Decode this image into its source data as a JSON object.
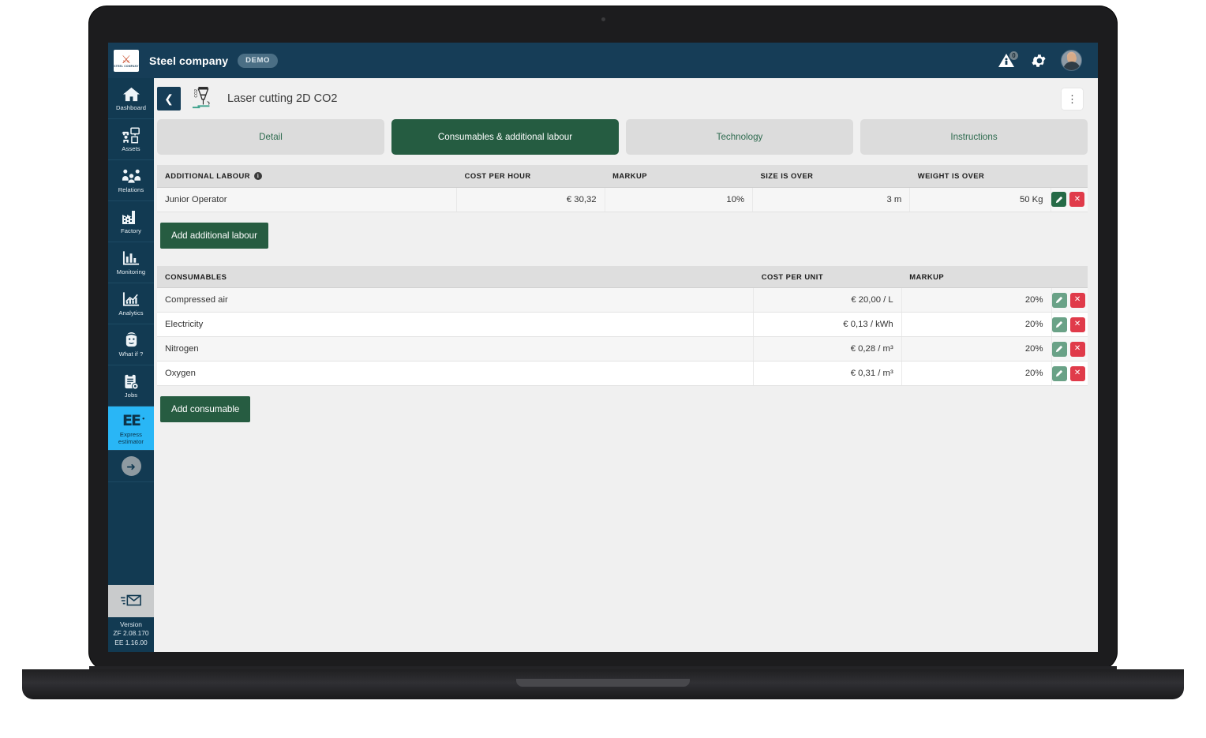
{
  "topbar": {
    "logo_mark": "steel-company-logo",
    "logo_text": "STEEL COMPANY",
    "company": "Steel company",
    "demo_badge": "DEMO",
    "alert_count": "0",
    "icons": [
      "alert-triangle-icon",
      "gear-icon",
      "avatar"
    ]
  },
  "sidebar": {
    "items": [
      {
        "label": "Dashboard",
        "icon": "home-icon",
        "active": false
      },
      {
        "label": "Assets",
        "icon": "assets-icon",
        "active": false
      },
      {
        "label": "Relations",
        "icon": "relations-icon",
        "active": false
      },
      {
        "label": "Factory",
        "icon": "factory-icon",
        "active": false
      },
      {
        "label": "Monitoring",
        "icon": "bar-chart-icon",
        "active": false
      },
      {
        "label": "Analytics",
        "icon": "analytics-icon",
        "active": false
      },
      {
        "label": "What if ?",
        "icon": "face-thinking-icon",
        "active": false
      },
      {
        "label": "Jobs",
        "icon": "clipboard-gear-icon",
        "active": false
      },
      {
        "label": "Express estimator",
        "icon": "ee-logo-icon",
        "active": true
      }
    ],
    "collapse_arrow": "arrow-right-circle-icon",
    "mail_icon": "mail-send-icon",
    "version_label": "Version",
    "version_zf": "ZF  2.08.170",
    "version_ee": "EE  1.16.00"
  },
  "page": {
    "back_icon": "chevron-left-icon",
    "title_icon": "laser-cutting-co2-icon",
    "title": "Laser cutting 2D CO2",
    "kebab_icon": "more-vertical-icon"
  },
  "tabs": [
    {
      "label": "Detail",
      "active": false
    },
    {
      "label": "Consumables & additional labour",
      "active": true
    },
    {
      "label": "Technology",
      "active": false
    },
    {
      "label": "Instructions",
      "active": false
    }
  ],
  "additional_labour": {
    "headers": [
      "ADDITIONAL LABOUR",
      "COST PER HOUR",
      "MARKUP",
      "SIZE IS OVER",
      "WEIGHT IS OVER",
      ""
    ],
    "header_info_icon": "info-icon",
    "rows": [
      {
        "name": "Junior Operator",
        "cost_per_hour": "€ 30,32",
        "markup": "10%",
        "size_is_over": "3 m",
        "weight_is_over": "50 Kg",
        "edit_icon": "pencil-icon",
        "delete_icon": "close-icon"
      }
    ],
    "add_button": "Add additional labour"
  },
  "consumables": {
    "headers": [
      "CONSUMABLES",
      "COST PER UNIT",
      "MARKUP",
      ""
    ],
    "rows": [
      {
        "name": "Compressed air",
        "cost_per_unit": "€ 20,00 / L",
        "markup": "20%",
        "edit_icon": "pencil-icon",
        "delete_icon": "close-icon"
      },
      {
        "name": "Electricity",
        "cost_per_unit": "€ 0,13 / kWh",
        "markup": "20%",
        "edit_icon": "pencil-icon",
        "delete_icon": "close-icon"
      },
      {
        "name": "Nitrogen",
        "cost_per_unit": "€ 0,28 / m³",
        "markup": "20%",
        "edit_icon": "pencil-icon",
        "delete_icon": "close-icon"
      },
      {
        "name": "Oxygen",
        "cost_per_unit": "€ 0,31 / m³",
        "markup": "20%",
        "edit_icon": "pencil-icon",
        "delete_icon": "close-icon"
      }
    ],
    "add_button": "Add consumable"
  },
  "colors": {
    "navy": "#123a52",
    "topbar": "#163d57",
    "green": "#265c41",
    "green_light": "#6aa287",
    "red": "#e03b4a",
    "active_blue": "#29b6f6",
    "tab_inactive": "#dcdcdc",
    "tab_text": "#2e6b4f"
  }
}
